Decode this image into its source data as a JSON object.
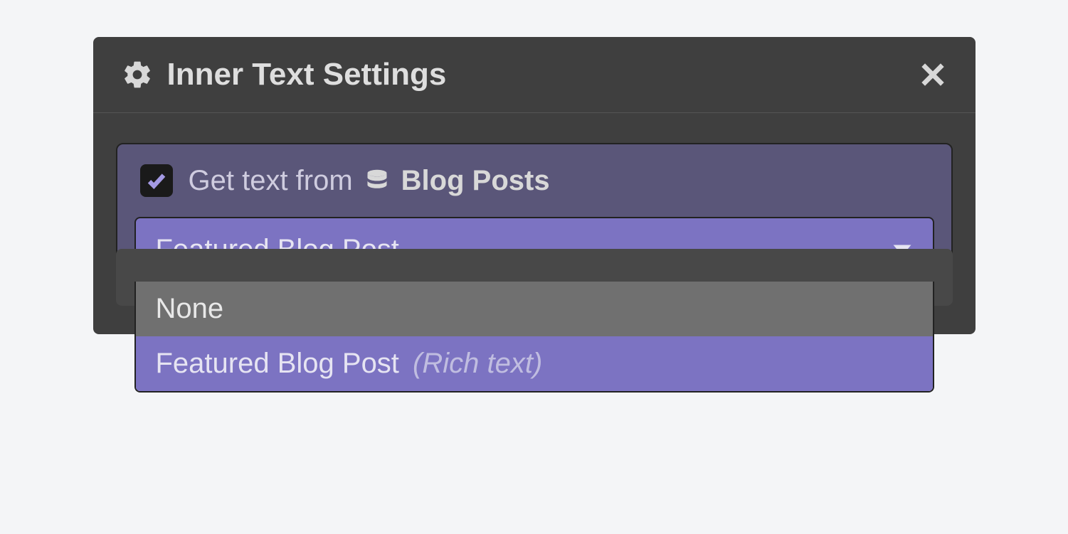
{
  "panel": {
    "title": "Inner Text Settings"
  },
  "binding": {
    "checked": true,
    "label_prefix": "Get text from",
    "collection_name": "Blog Posts"
  },
  "select": {
    "value": "Featured Blog Post",
    "options": [
      {
        "label": "None",
        "type": ""
      },
      {
        "label": "Featured Blog Post",
        "type": "(Rich text)"
      }
    ]
  }
}
